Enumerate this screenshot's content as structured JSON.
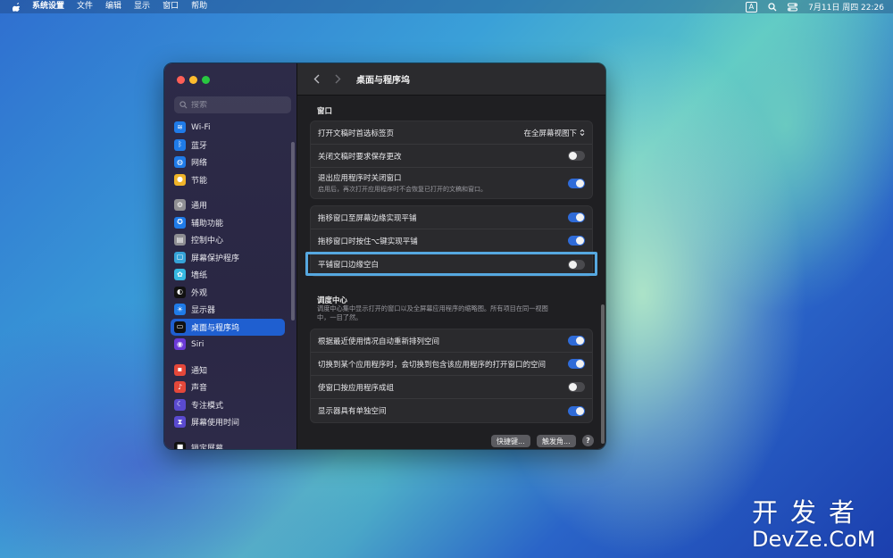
{
  "menubar": {
    "app": "系统设置",
    "items": [
      "文件",
      "编辑",
      "显示",
      "窗口",
      "帮助"
    ],
    "input_indicator": "A",
    "datetime": "7月11日 周四  22:26"
  },
  "sidebar": {
    "search_placeholder": "搜索",
    "groups": [
      [
        {
          "label": "Wi-Fi",
          "icon": "wifi-icon",
          "color": "#1f7be8"
        },
        {
          "label": "蓝牙",
          "icon": "bluetooth-icon",
          "color": "#1f7be8"
        },
        {
          "label": "网络",
          "icon": "globe-icon",
          "color": "#1f7be8"
        },
        {
          "label": "节能",
          "icon": "bulb-icon",
          "color": "#f0b429"
        }
      ],
      [
        {
          "label": "通用",
          "icon": "gear-icon",
          "color": "#8e8e93"
        },
        {
          "label": "辅助功能",
          "icon": "accessibility-icon",
          "color": "#1f7be8"
        },
        {
          "label": "控制中心",
          "icon": "control-center-icon",
          "color": "#8e8e93"
        },
        {
          "label": "屏幕保护程序",
          "icon": "screensaver-icon",
          "color": "#35a3d8"
        },
        {
          "label": "墙纸",
          "icon": "wallpaper-icon",
          "color": "#35b8e0"
        },
        {
          "label": "外观",
          "icon": "appearance-icon",
          "color": "#111111"
        },
        {
          "label": "显示器",
          "icon": "display-icon",
          "color": "#1f7be8"
        },
        {
          "label": "桌面与程序坞",
          "icon": "dock-icon",
          "color": "#111111",
          "active": true
        },
        {
          "label": "Siri",
          "icon": "siri-icon",
          "color": "#6b3ad8"
        }
      ],
      [
        {
          "label": "通知",
          "icon": "bell-icon",
          "color": "#e5483a"
        },
        {
          "label": "声音",
          "icon": "speaker-icon",
          "color": "#e5483a"
        },
        {
          "label": "专注模式",
          "icon": "moon-icon",
          "color": "#5a4ad0"
        },
        {
          "label": "屏幕使用时间",
          "icon": "hourglass-icon",
          "color": "#5a4ad0"
        }
      ],
      [
        {
          "label": "锁定屏幕",
          "icon": "lock-icon",
          "color": "#111111"
        }
      ]
    ]
  },
  "main": {
    "title": "桌面与程序坞",
    "window_section": {
      "title": "窗口",
      "rows": [
        {
          "label": "打开文稿时首选标签页",
          "type": "select",
          "value": "在全屏幕视图下"
        },
        {
          "label": "关闭文稿时要求保存更改",
          "type": "toggle",
          "on": false
        },
        {
          "label": "退出应用程序时关闭窗口",
          "sub": "启用后，再次打开应用程序时不会恢复已打开的文稿和窗口。",
          "type": "toggle",
          "on": true
        }
      ]
    },
    "tiling_rows": [
      {
        "label": "拖移窗口至屏幕边缘实现平铺",
        "on": true
      },
      {
        "label": "拖移窗口时按住⌥键实现平铺",
        "on": true
      },
      {
        "label": "平铺窗口边缘空白",
        "on": false
      }
    ],
    "mission_control": {
      "title": "调度中心",
      "desc": "调度中心集中显示打开的窗口以及全屏幕应用程序的缩略图。所有项目在同一视图中，一目了然。",
      "rows": [
        {
          "label": "根据最近使用情况自动重新排列空间",
          "on": true
        },
        {
          "label": "切换到某个应用程序时，会切换到包含该应用程序的打开窗口的空间",
          "on": true
        },
        {
          "label": "使窗口按应用程序成组",
          "on": false
        },
        {
          "label": "显示器具有单独空间",
          "on": true
        }
      ]
    },
    "buttons": {
      "shortcuts": "快捷键...",
      "hot_corners": "触发角...",
      "help": "?"
    }
  },
  "watermark": {
    "cn": "开发者",
    "en": "DevZe.CoM"
  }
}
